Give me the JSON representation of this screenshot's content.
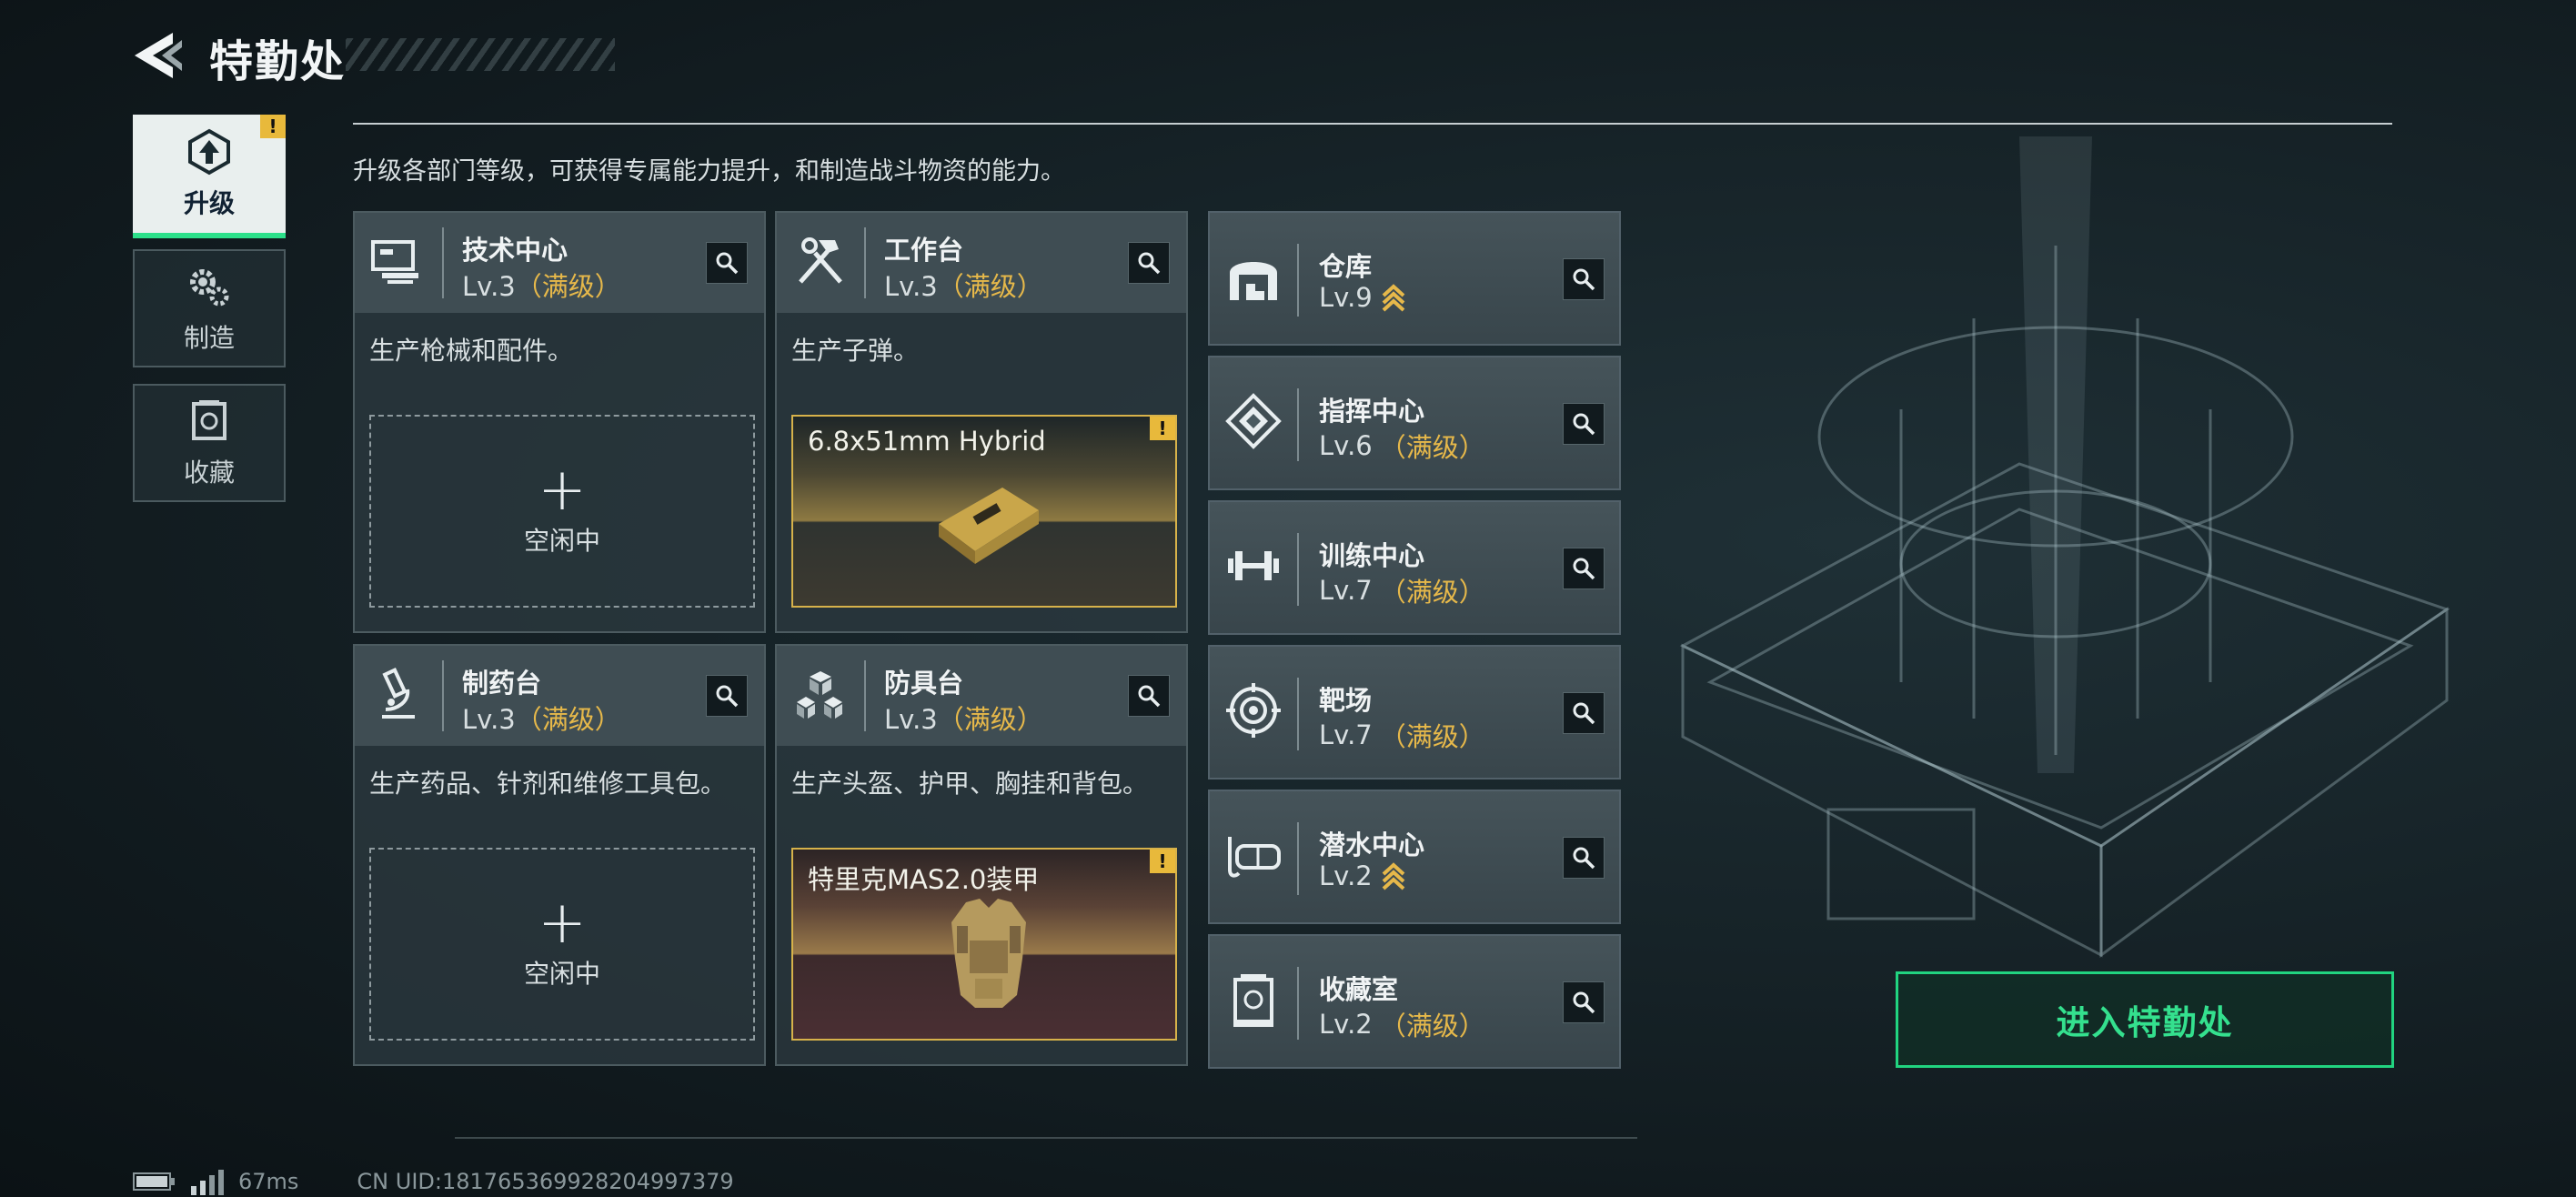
{
  "header": {
    "title": "特勤处"
  },
  "nav": [
    {
      "label": "升级",
      "icon": "upgrade-icon",
      "active": true,
      "alert": "!"
    },
    {
      "label": "制造",
      "icon": "gears-icon",
      "active": false
    },
    {
      "label": "收藏",
      "icon": "collection-icon",
      "active": false
    }
  ],
  "description": "升级各部门等级，可获得专属能力提升，和制造战斗物资的能力。",
  "workstations": [
    {
      "name": "技术中心",
      "level": "Lv.3",
      "status": "（满级）",
      "icon": "tech-center-icon",
      "desc": "生产枪械和配件。",
      "slot": {
        "type": "idle",
        "plus": "+",
        "label": "空闲中"
      }
    },
    {
      "name": "工作台",
      "level": "Lv.3",
      "status": "（满级）",
      "icon": "workbench-icon",
      "desc": "生产子弹。",
      "slot": {
        "type": "crafting",
        "item": "6.8x51mm Hybrid",
        "alert": "!"
      }
    },
    {
      "name": "制药台",
      "level": "Lv.3",
      "status": "（满级）",
      "icon": "pharmacy-icon",
      "desc": "生产药品、针剂和维修工具包。",
      "slot": {
        "type": "idle",
        "plus": "+",
        "label": "空闲中"
      }
    },
    {
      "name": "防具台",
      "level": "Lv.3",
      "status": "（满级）",
      "icon": "armor-bench-icon",
      "desc": "生产头盔、护甲、胸挂和背包。",
      "slot": {
        "type": "crafting",
        "item": "特里克MAS2.0装甲",
        "alert": "!"
      }
    }
  ],
  "facilities": [
    {
      "name": "仓库",
      "level": "Lv.9",
      "status": "",
      "upgradable": true,
      "icon": "warehouse-icon"
    },
    {
      "name": "指挥中心",
      "level": "Lv.6",
      "status": "（满级）",
      "upgradable": false,
      "icon": "command-center-icon"
    },
    {
      "name": "训练中心",
      "level": "Lv.7",
      "status": "（满级）",
      "upgradable": false,
      "icon": "dumbbell-icon"
    },
    {
      "name": "靶场",
      "level": "Lv.7",
      "status": "（满级）",
      "upgradable": false,
      "icon": "target-icon"
    },
    {
      "name": "潜水中心",
      "level": "Lv.2",
      "status": "",
      "upgradable": true,
      "icon": "diving-mask-icon"
    },
    {
      "name": "收藏室",
      "level": "Lv.2",
      "status": "（满级）",
      "upgradable": false,
      "icon": "collection-room-icon"
    }
  ],
  "enter_button": "进入特勤处",
  "status": {
    "ping": "67ms",
    "uid": "CN UID:181765369928204997379"
  },
  "colors": {
    "accent_green": "#2ce08a",
    "gold": "#e6b84a",
    "alert_yellow": "#e8b93b"
  }
}
